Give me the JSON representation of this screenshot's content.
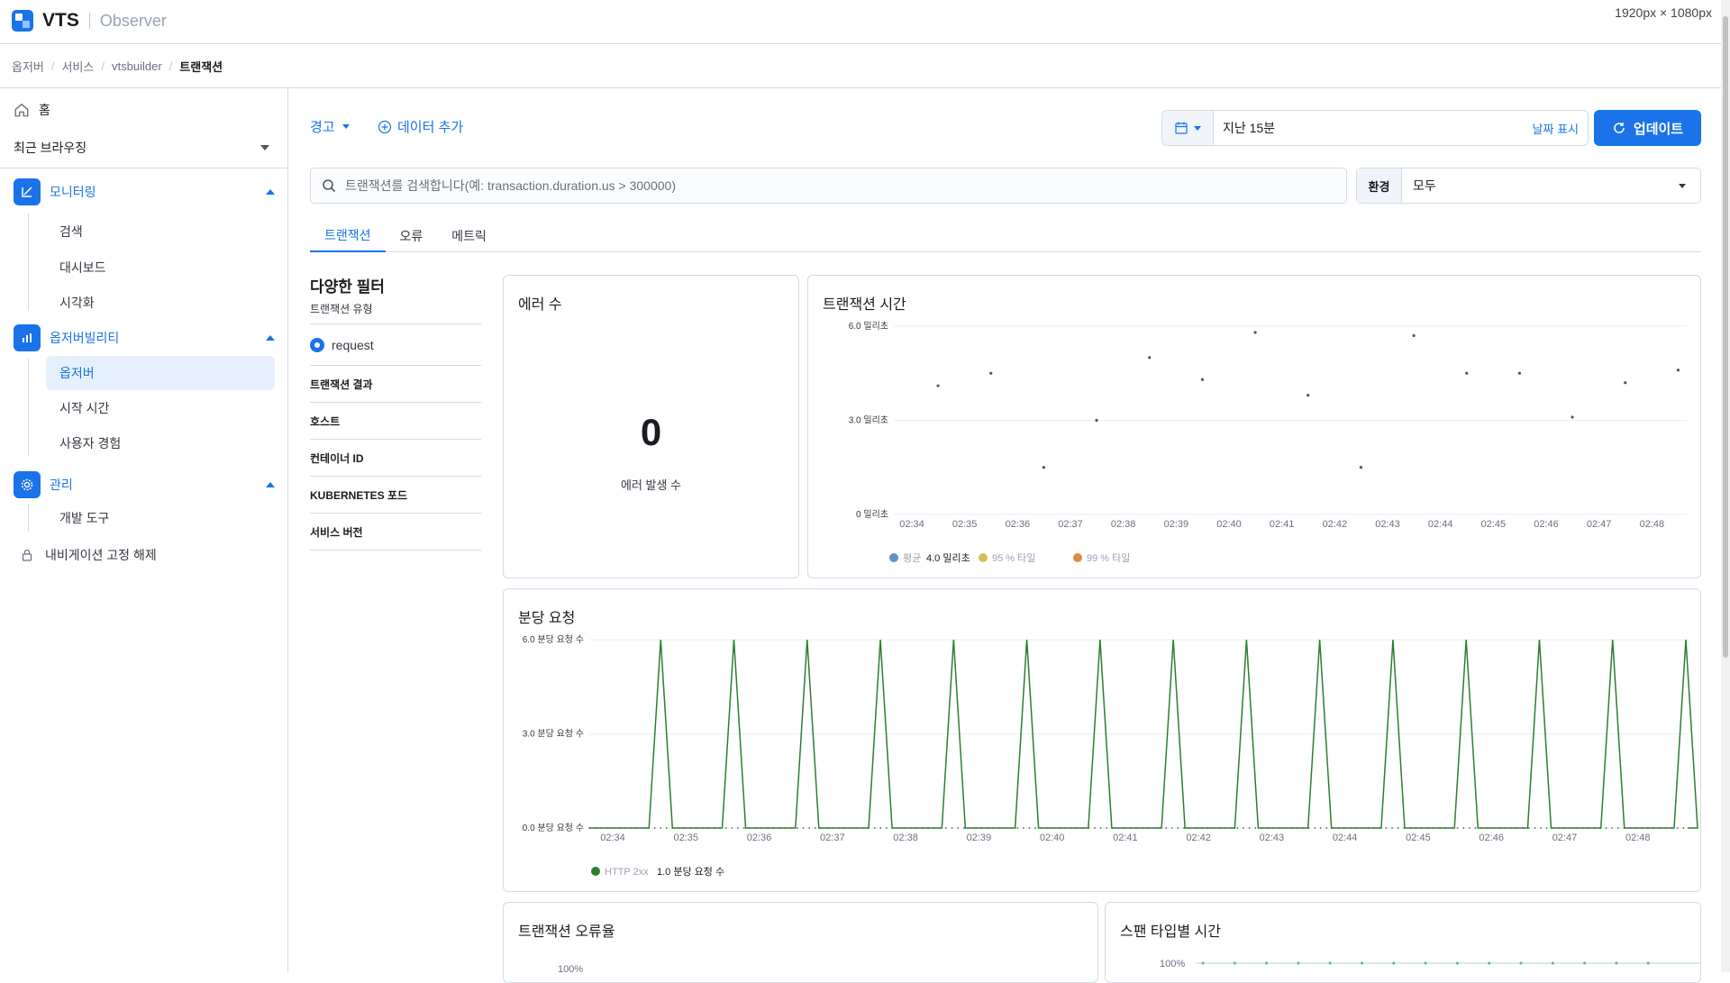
{
  "header": {
    "brand": "VTS",
    "product": "Observer",
    "dimensions": "1920px × 1080px"
  },
  "breadcrumbs": [
    "옵저버",
    "서비스",
    "vtsbuilder",
    "트랜잭션"
  ],
  "sidebar": {
    "home": "홈",
    "recent": "최근 브라우징",
    "groups": [
      {
        "label": "모니터링",
        "items": [
          "검색",
          "대시보드",
          "시각화"
        ]
      },
      {
        "label": "옵저버빌리티",
        "items": [
          "옵저버",
          "시작 시간",
          "사용자 경험"
        ]
      },
      {
        "label": "관리",
        "items": [
          "개발 도구"
        ]
      }
    ],
    "unpin": "내비게이션 고정 해제"
  },
  "toolbar": {
    "alerts": "경고",
    "add_data": "데이터 추가",
    "time_range": "지난 15분",
    "show_dates": "날짜 표시",
    "update": "업데이트"
  },
  "search": {
    "placeholder": "트랜잭션를 검색합니다(예: transaction.duration.us > 300000)"
  },
  "environment": {
    "label": "환경",
    "value": "모두"
  },
  "tabs": [
    "트랜잭션",
    "오류",
    "메트릭"
  ],
  "filters": {
    "title": "다양한 필터",
    "type_label": "트랜잭션 유형",
    "type_value": "request",
    "items": [
      "트랜잭션 결과",
      "호스트",
      "컨테이너 ID",
      "KUBERNETES 포드",
      "서비스 버전"
    ]
  },
  "error_panel": {
    "title": "에러 수",
    "value": "0",
    "caption": "에러 발생 수"
  },
  "panels": {
    "error_rate_title": "트랜잭션 오류율",
    "error_rate_tick": "100%",
    "span_title": "스팬 타입별 시간",
    "span_tick": "100%"
  },
  "chart_data": [
    {
      "type": "scatter",
      "title": "트랜잭션 시간",
      "y_ticks": [
        "0 밀리초",
        "3.0 밀리초",
        "6.0 밀리초"
      ],
      "ylim": [
        0,
        6
      ],
      "x_ticks": [
        "02:34",
        "02:35",
        "02:36",
        "02:37",
        "02:38",
        "02:39",
        "02:40",
        "02:41",
        "02:42",
        "02:43",
        "02:44",
        "02:45",
        "02:46",
        "02:47",
        "02:48"
      ],
      "x": [
        0.7,
        1.7,
        2.7,
        3.7,
        4.7,
        5.7,
        6.7,
        7.7,
        8.7,
        9.7,
        10.7,
        11.7,
        12.7,
        13.7,
        14.7
      ],
      "values": [
        4.1,
        4.5,
        1.5,
        3.0,
        5.0,
        4.3,
        5.8,
        3.8,
        1.5,
        5.7,
        4.5,
        4.5,
        3.1,
        4.2,
        4.6
      ],
      "legend": [
        {
          "name": "평균",
          "value": "4.0 밀리초",
          "color": "#6092c0"
        },
        {
          "name": "95 % 타일",
          "value": "",
          "color": "#d6bf57"
        },
        {
          "name": "99 % 타일",
          "value": "",
          "color": "#da8b45"
        }
      ]
    },
    {
      "type": "line",
      "title": "분당 요청",
      "y_ticks": [
        "0.0 분당 요청 수",
        "3.0 분당 요청 수",
        "6.0 분당 요청 수"
      ],
      "ylim": [
        0,
        6
      ],
      "x_ticks": [
        "02:34",
        "02:35",
        "02:36",
        "02:37",
        "02:38",
        "02:39",
        "02:40",
        "02:41",
        "02:42",
        "02:43",
        "02:44",
        "02:45",
        "02:46",
        "02:47",
        "02:48"
      ],
      "peaks_x": [
        1.0,
        2.0,
        3.0,
        4.0,
        5.0,
        6.0,
        7.0,
        8.0,
        9.0,
        10.0,
        11.0,
        12.0,
        13.0,
        14.0,
        15.0
      ],
      "peak_value": 6,
      "series": [
        {
          "name": "HTTP 2xx",
          "value": "1.0 분당 요청 수",
          "color": "#2e7d32"
        }
      ]
    }
  ]
}
